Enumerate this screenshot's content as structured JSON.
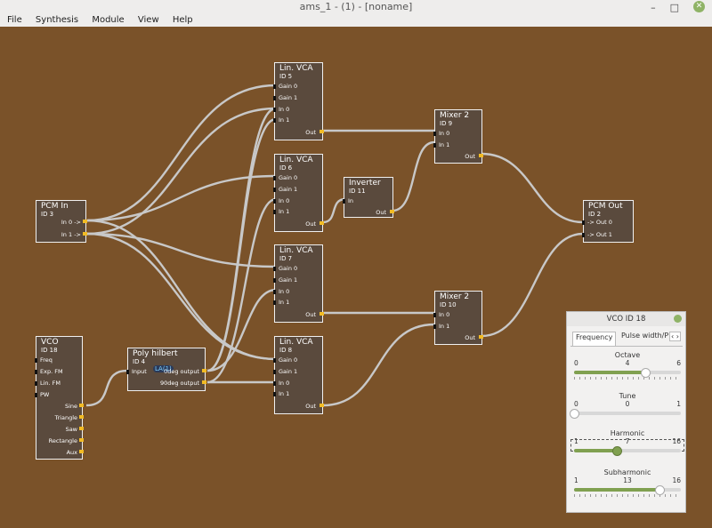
{
  "window": {
    "title": "ams_1 - (1) - [noname]",
    "min_symbol": "–",
    "max_symbol": "□",
    "close_symbol": "✕"
  },
  "menu": [
    "File",
    "Synthesis",
    "Module",
    "View",
    "Help"
  ],
  "modules": {
    "vca5": {
      "title": "Lin. VCA",
      "id": "ID 5",
      "ports": [
        "Gain 0",
        "Gain 1",
        "In 0",
        "In 1",
        "Out"
      ]
    },
    "vca6": {
      "title": "Lin. VCA",
      "id": "ID 6",
      "ports": [
        "Gain 0",
        "Gain 1",
        "In 0",
        "In 1",
        "Out"
      ]
    },
    "vca7": {
      "title": "Lin. VCA",
      "id": "ID 7",
      "ports": [
        "Gain 0",
        "Gain 1",
        "In 0",
        "In 1",
        "Out"
      ]
    },
    "vca8": {
      "title": "Lin. VCA",
      "id": "ID 8",
      "ports": [
        "Gain 0",
        "Gain 1",
        "In 0",
        "In 1",
        "Out"
      ]
    },
    "mixer9": {
      "title": "Mixer 2",
      "id": "ID 9",
      "ports": [
        "In 0",
        "In 1",
        "Out"
      ]
    },
    "mixer10": {
      "title": "Mixer 2",
      "id": "ID 10",
      "ports": [
        "In 0",
        "In 1",
        "Out"
      ]
    },
    "inverter": {
      "title": "Inverter",
      "id": "ID 11",
      "ports": [
        "In",
        "Out"
      ]
    },
    "pcmin": {
      "title": "PCM In",
      "id": "ID 3",
      "ports": [
        "In  0 ->",
        "In  1 ->"
      ]
    },
    "pcmout": {
      "title": "PCM Out",
      "id": "ID 2",
      "ports": [
        "-> Out  0",
        "-> Out  1"
      ]
    },
    "vco": {
      "title": "VCO",
      "id": "ID 18",
      "ports": [
        "Freq",
        "Exp. FM",
        "Lin. FM",
        "PW",
        "Sine",
        "Triangle",
        "Saw",
        "Rectangle",
        "Aux"
      ]
    },
    "hilbert": {
      "title": "Poly hilbert",
      "id": "ID 4",
      "ports": [
        "Input",
        "0deg output",
        "90deg output"
      ],
      "overlay": "LA(1)"
    }
  },
  "dialog": {
    "title": "VCO ID 18",
    "tabs": [
      "Frequency",
      "Pulse width/P"
    ],
    "tab_arrows": "‹ ›",
    "sliders": [
      {
        "label": "Octave",
        "min": "0",
        "value": "4",
        "max": "6",
        "fraction": 0.667
      },
      {
        "label": "Tune",
        "min": "0",
        "value": "0",
        "max": "1",
        "fraction": 0.0
      },
      {
        "label": "Harmonic",
        "min": "1",
        "value": "7",
        "max": "16",
        "fraction": 0.4
      },
      {
        "label": "Subharmonic",
        "min": "1",
        "value": "13",
        "max": "16",
        "fraction": 0.8
      }
    ]
  },
  "colors": {
    "canvas": "#7a5229",
    "module": "#5a4a3d",
    "wire": "#c8c8c8",
    "port": "#f2bb24",
    "accent": "#80a050"
  }
}
